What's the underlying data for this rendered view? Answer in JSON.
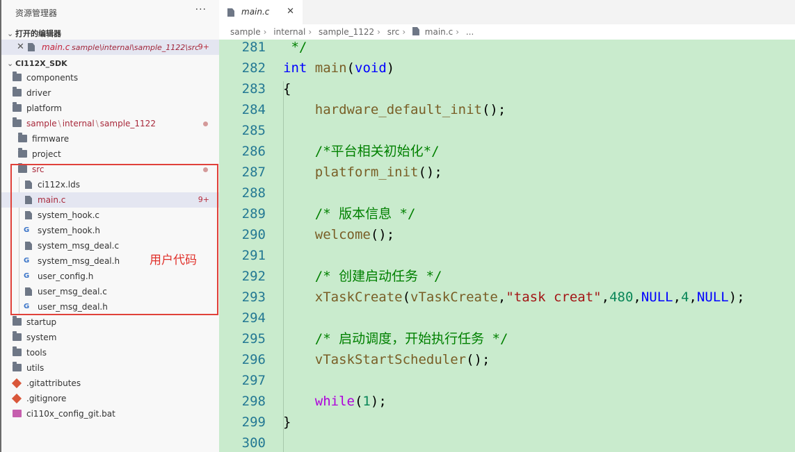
{
  "explorer": {
    "title": "资源管理器",
    "more": "···",
    "open_editors_title": "打开的编辑器",
    "open_editor": {
      "name": "main.c",
      "path": "sample\\internal\\sample_1122\\src",
      "badge": "9+"
    },
    "project_title": "CI112X_SDK",
    "tree": {
      "components": "components",
      "driver": "driver",
      "platform": "platform",
      "sample_path": [
        "sample",
        "internal",
        "sample_1122"
      ],
      "firmware": "firmware",
      "project": "project",
      "src": "src",
      "files": [
        "ci112x.lds",
        "main.c",
        "system_hook.c",
        "system_hook.h",
        "system_msg_deal.c",
        "system_msg_deal.h",
        "user_config.h",
        "user_msg_deal.c",
        "user_msg_deal.h"
      ],
      "main_badge": "9+",
      "startup": "startup",
      "system": "system",
      "tools": "tools",
      "utils": "utils",
      "gitattributes": ".gitattributes",
      "gitignore": ".gitignore",
      "bat": "ci110x_config_git.bat"
    },
    "annotation": "用户代码"
  },
  "editor": {
    "tab": {
      "name": "main.c",
      "close": "✕"
    },
    "breadcrumb": [
      "sample",
      "internal",
      "sample_1122",
      "src",
      "main.c",
      "..."
    ],
    "lines": [
      {
        "n": "281",
        "tokens": [
          {
            "t": " */",
            "c": "k-cm"
          }
        ]
      },
      {
        "n": "282",
        "tokens": [
          {
            "t": "int",
            "c": "k-blue"
          },
          {
            "t": " ",
            "c": "k-pn"
          },
          {
            "t": "main",
            "c": "k-fn"
          },
          {
            "t": "(",
            "c": "k-pn"
          },
          {
            "t": "void",
            "c": "k-blue"
          },
          {
            "t": ")",
            "c": "k-pn"
          }
        ]
      },
      {
        "n": "283",
        "tokens": [
          {
            "t": "{",
            "c": "k-pn"
          }
        ]
      },
      {
        "n": "284",
        "tokens": [
          {
            "t": "    hardware_default_init",
            "c": "k-fn"
          },
          {
            "t": "();",
            "c": "k-pn"
          }
        ]
      },
      {
        "n": "285",
        "tokens": []
      },
      {
        "n": "286",
        "tokens": [
          {
            "t": "    /*平台相关初始化*/",
            "c": "k-cm"
          }
        ]
      },
      {
        "n": "287",
        "tokens": [
          {
            "t": "    platform_init",
            "c": "k-fn"
          },
          {
            "t": "();",
            "c": "k-pn"
          }
        ]
      },
      {
        "n": "288",
        "tokens": []
      },
      {
        "n": "289",
        "tokens": [
          {
            "t": "    /* 版本信息 */",
            "c": "k-cm"
          }
        ]
      },
      {
        "n": "290",
        "tokens": [
          {
            "t": "    welcome",
            "c": "k-fn"
          },
          {
            "t": "();",
            "c": "k-pn"
          }
        ]
      },
      {
        "n": "291",
        "tokens": []
      },
      {
        "n": "292",
        "tokens": [
          {
            "t": "    /* 创建启动任务 */",
            "c": "k-cm"
          }
        ]
      },
      {
        "n": "293",
        "tokens": [
          {
            "t": "    xTaskCreate",
            "c": "k-fn"
          },
          {
            "t": "(",
            "c": "k-pn"
          },
          {
            "t": "vTaskCreate",
            "c": "k-fn"
          },
          {
            "t": ",",
            "c": "k-pn"
          },
          {
            "t": "\"task creat\"",
            "c": "k-str"
          },
          {
            "t": ",",
            "c": "k-pn"
          },
          {
            "t": "480",
            "c": "k-num"
          },
          {
            "t": ",",
            "c": "k-pn"
          },
          {
            "t": "NULL",
            "c": "k-blue"
          },
          {
            "t": ",",
            "c": "k-pn"
          },
          {
            "t": "4",
            "c": "k-num"
          },
          {
            "t": ",",
            "c": "k-pn"
          },
          {
            "t": "NULL",
            "c": "k-blue"
          },
          {
            "t": ");",
            "c": "k-pn"
          }
        ]
      },
      {
        "n": "294",
        "tokens": []
      },
      {
        "n": "295",
        "tokens": [
          {
            "t": "    /* 启动调度，开始执行任务 */",
            "c": "k-cm"
          }
        ]
      },
      {
        "n": "296",
        "tokens": [
          {
            "t": "    vTaskStartScheduler",
            "c": "k-fn"
          },
          {
            "t": "();",
            "c": "k-pn"
          }
        ]
      },
      {
        "n": "297",
        "tokens": []
      },
      {
        "n": "298",
        "tokens": [
          {
            "t": "    ",
            "c": "k-pn"
          },
          {
            "t": "while",
            "c": "k-ctl"
          },
          {
            "t": "(",
            "c": "k-pn"
          },
          {
            "t": "1",
            "c": "k-num"
          },
          {
            "t": ");",
            "c": "k-pn"
          }
        ]
      },
      {
        "n": "299",
        "tokens": [
          {
            "t": "}",
            "c": "k-pn"
          }
        ]
      },
      {
        "n": "300",
        "tokens": []
      }
    ]
  }
}
